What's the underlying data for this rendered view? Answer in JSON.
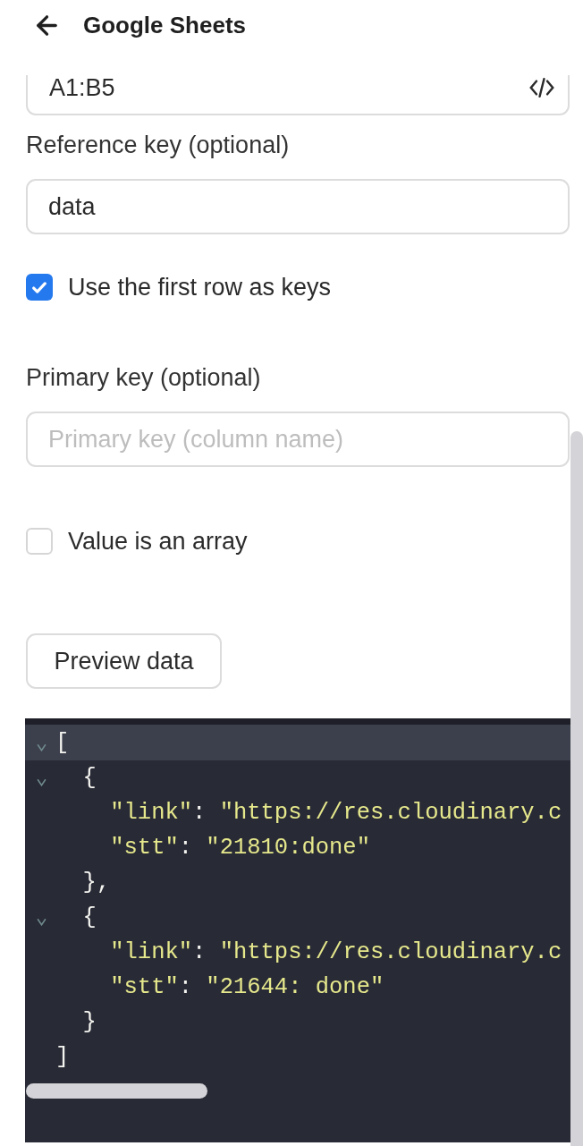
{
  "header": {
    "title": "Google Sheets"
  },
  "form": {
    "range_field": {
      "value": "A1:B5"
    },
    "reference_key": {
      "label": "Reference key (optional)",
      "value": "data"
    },
    "first_row_as_keys": {
      "label": "Use the first row as keys",
      "checked": true
    },
    "primary_key": {
      "label": "Primary key (optional)",
      "placeholder": "Primary key (column name)"
    },
    "value_is_array": {
      "label": "Value is an array",
      "checked": false
    },
    "preview_button": "Preview data"
  },
  "preview": {
    "lines": [
      {
        "foldable": true,
        "expanded": true,
        "active": true,
        "tokens": [
          {
            "kind": "punct",
            "text": "["
          }
        ]
      },
      {
        "foldable": true,
        "expanded": true,
        "active": false,
        "tokens": [
          {
            "kind": "punct",
            "text": "  {"
          }
        ]
      },
      {
        "foldable": false,
        "active": false,
        "tokens": [
          {
            "kind": "string",
            "text": "    \"link\""
          },
          {
            "kind": "punct",
            "text": ": "
          },
          {
            "kind": "string",
            "text": "\"https://res.cloudinary.c"
          }
        ]
      },
      {
        "foldable": false,
        "active": false,
        "tokens": [
          {
            "kind": "string",
            "text": "    \"stt\""
          },
          {
            "kind": "punct",
            "text": ": "
          },
          {
            "kind": "string",
            "text": "\"21810:done\""
          }
        ]
      },
      {
        "foldable": false,
        "active": false,
        "tokens": [
          {
            "kind": "punct",
            "text": "  },"
          }
        ]
      },
      {
        "foldable": true,
        "expanded": true,
        "active": false,
        "tokens": [
          {
            "kind": "punct",
            "text": "  {"
          }
        ]
      },
      {
        "foldable": false,
        "active": false,
        "tokens": [
          {
            "kind": "string",
            "text": "    \"link\""
          },
          {
            "kind": "punct",
            "text": ": "
          },
          {
            "kind": "string",
            "text": "\"https://res.cloudinary.c"
          }
        ]
      },
      {
        "foldable": false,
        "active": false,
        "tokens": [
          {
            "kind": "string",
            "text": "    \"stt\""
          },
          {
            "kind": "punct",
            "text": ": "
          },
          {
            "kind": "string",
            "text": "\"21644: done\""
          }
        ]
      },
      {
        "foldable": false,
        "active": false,
        "tokens": [
          {
            "kind": "punct",
            "text": "  }"
          }
        ]
      },
      {
        "foldable": false,
        "active": false,
        "tokens": [
          {
            "kind": "punct",
            "text": "]"
          }
        ]
      }
    ]
  }
}
